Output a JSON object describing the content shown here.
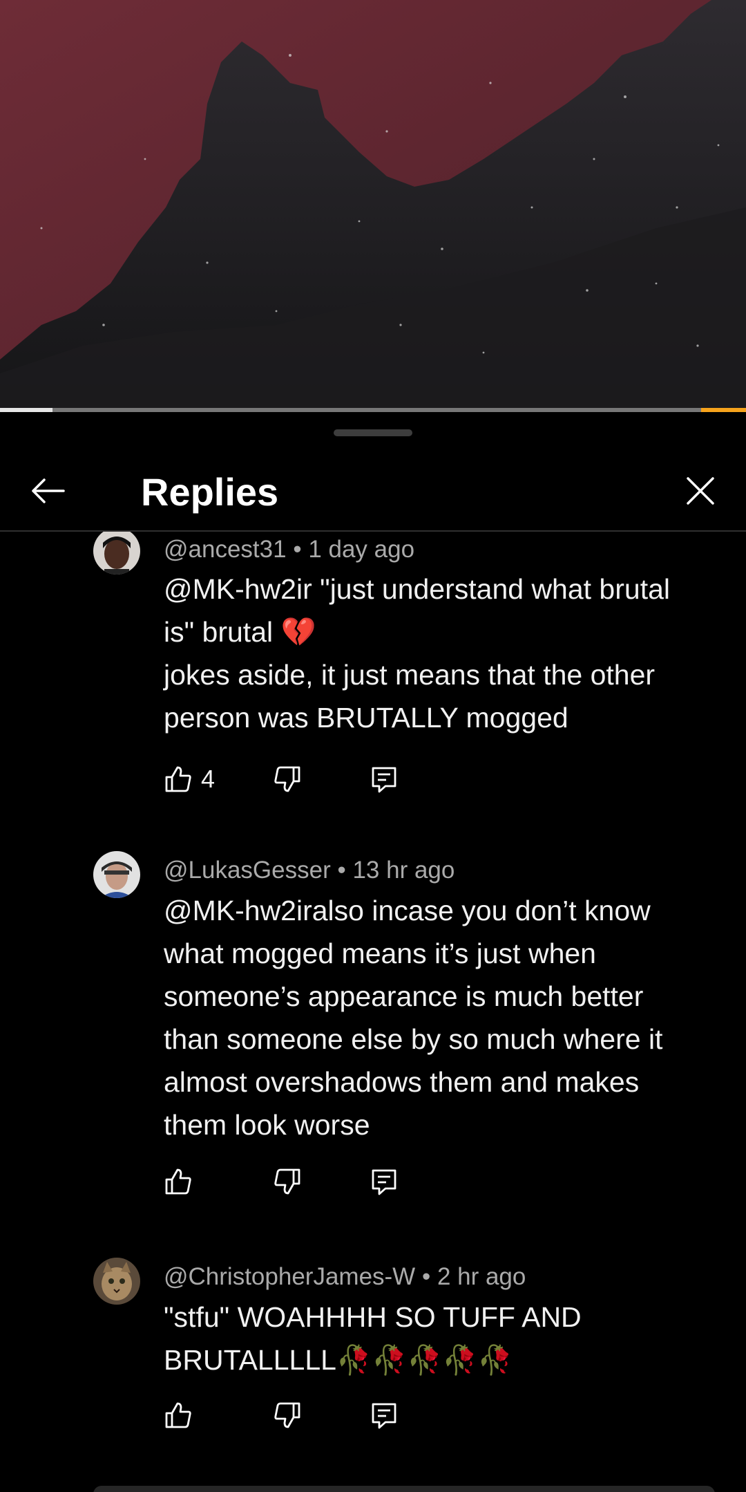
{
  "header": {
    "title": "Replies"
  },
  "video": {
    "progress": 0.07,
    "accent_color": "#f6a31c",
    "sky_color": "#6a2a35"
  },
  "comments": [
    {
      "author": "@ancest31",
      "time": "1 day ago",
      "text": "@MK-hw2ir \"just understand what brutal is\" brutal 💔\njokes aside, it just means that the other person was BRUTALLY mogged",
      "likes": "4"
    },
    {
      "author": "@LukasGesser",
      "time": "13 hr ago",
      "text": "@MK-hw2iralso incase you don’t know what mogged means it’s just when someone’s appearance is much better than someone else by so much where it almost overshadows them and makes them look worse",
      "likes": ""
    },
    {
      "author": "@ChristopherJames-W",
      "time": "2 hr ago",
      "text": "\"stfu\"  WOAHHHH SO TUFF AND BRUTALLLLL🥀🥀🥀🥀🥀",
      "likes": ""
    }
  ],
  "icons": {
    "back": "arrow-left-icon",
    "close": "close-icon",
    "like": "thumbs-up-icon",
    "dislike": "thumbs-down-icon",
    "reply": "reply-icon"
  }
}
